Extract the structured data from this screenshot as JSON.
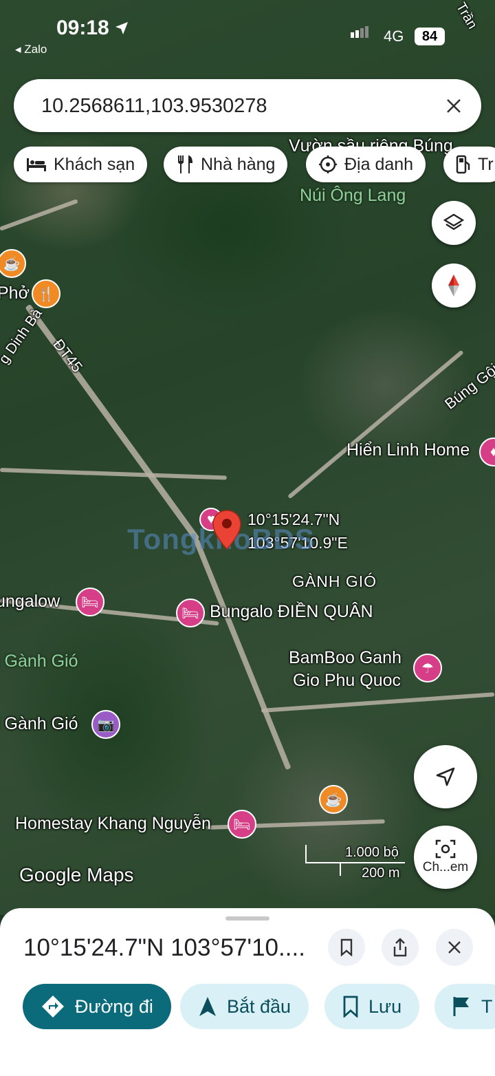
{
  "status_bar": {
    "time": "09:18",
    "back_app": "Zalo",
    "network": "4G",
    "battery": "84"
  },
  "search": {
    "value": "10.2568611,103.9530278",
    "clear_icon": "close-icon"
  },
  "chips": [
    {
      "label": "Khách sạn",
      "icon": "bed-icon"
    },
    {
      "label": "Nhà hàng",
      "icon": "fork-knife-icon"
    },
    {
      "label": "Địa danh",
      "icon": "landmark-icon"
    },
    {
      "label": "Tr",
      "icon": "gas-station-icon"
    }
  ],
  "map": {
    "labels": {
      "vuon_sau_rieng": "Vườn sầu riêng Búng",
      "nui_ong_lang": "Núi Ông Lang",
      "pho": "Phở",
      "dinh_ba": "g Dinh Bà",
      "dt45": "ĐT45",
      "bung_goi": "Búng Gội",
      "hien_linh_home": "Hiển Linh Home",
      "pin_coords_lat": "10°15'24.7\"N",
      "pin_coords_lng": "103°57'10.9\"E",
      "ganh_gio": "GÀNH GIÓ",
      "bungalow": "ungalow",
      "bungalo_dien_quan": "Bungalo ĐIỀN QUÂN",
      "ganh_gio_green": "i Gành Gió",
      "bamboo_line1": "BamBoo Ganh",
      "bamboo_line2": "Gio Phu Quoc",
      "ganh_gio_photo": "i Gành Gió",
      "homestay": "Homestay Khang Nguyễn",
      "tran": "Trần",
      "watermark": "TongkhoBDS"
    },
    "scale": {
      "imperial": "1.000 bộ",
      "metric": "200 m"
    },
    "google_logo": "Google Maps",
    "screenshot_label": "Ch...em"
  },
  "sheet": {
    "title": "10°15'24.7\"N 103°57'10....",
    "actions": [
      {
        "label": "Đường đi",
        "icon": "directions-icon",
        "primary": true
      },
      {
        "label": "Bắt đầu",
        "icon": "navigation-arrow-icon",
        "primary": false
      },
      {
        "label": "Lưu",
        "icon": "bookmark-icon",
        "primary": false
      },
      {
        "label": "T",
        "icon": "flag-icon",
        "primary": false
      }
    ]
  },
  "colors": {
    "accent": "#0b6b7a",
    "pin": "#ea4335",
    "secondary_bg": "#d9f0f7"
  }
}
